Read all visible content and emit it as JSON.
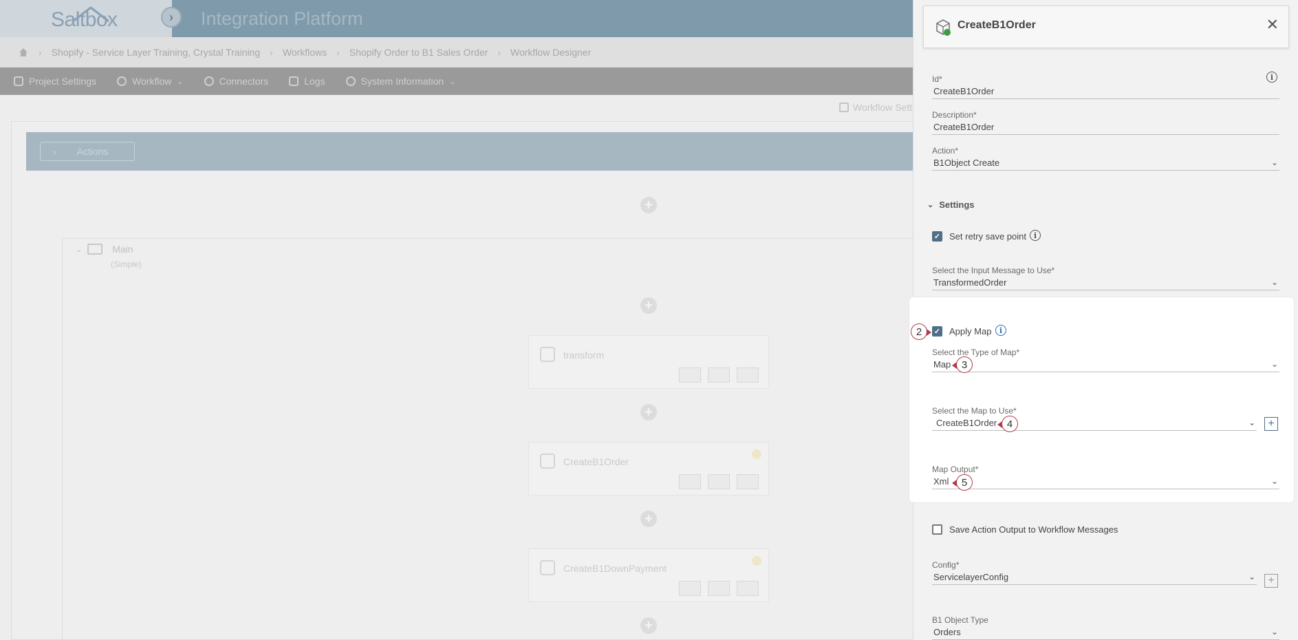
{
  "app": {
    "logo_text": "Saltbox",
    "title": "Integration Platform"
  },
  "breadcrumb": [
    "Shopify - Service Layer Training, Crystal Training",
    "Workflows",
    "Shopify Order to B1 Sales Order",
    "Workflow Designer"
  ],
  "menu": {
    "project_settings": "Project Settings",
    "workflow": "Workflow",
    "connectors": "Connectors",
    "logs": "Logs",
    "system_information": "System Information"
  },
  "workflow_settings_link": "Workflow Sett",
  "canvas": {
    "actions_label": "Actions",
    "main_label": "Main",
    "main_sub": "(Simple)",
    "nodes": [
      {
        "name": "transform"
      },
      {
        "name": "CreateB1Order"
      },
      {
        "name": "CreateB1DownPayment"
      }
    ]
  },
  "panel": {
    "title": "CreateB1Order",
    "id_label": "Id*",
    "id_value": "CreateB1Order",
    "description_label": "Description*",
    "description_value": "CreateB1Order",
    "action_label": "Action*",
    "action_value": "B1Object Create",
    "settings_label": "Settings",
    "retry_label": "Set retry save point",
    "input_message_label": "Select the Input Message to Use*",
    "input_message_value": "TransformedOrder",
    "apply_map_label": "Apply Map",
    "map_type_label": "Select the Type of Map*",
    "map_type_value": "Map",
    "map_use_label": "Select the Map to Use*",
    "map_use_value": "CreateB1Order",
    "map_output_label": "Map Output*",
    "map_output_value": "Xml",
    "save_output_label": "Save Action Output to Workflow Messages",
    "config_label": "Config*",
    "config_value": "ServicelayerConfig",
    "object_type_label": "B1 Object Type",
    "object_type_value": "Orders"
  },
  "callouts": {
    "c2": "2",
    "c3": "3",
    "c4": "4",
    "c5": "5"
  },
  "colors": {
    "accent": "#4f6e87",
    "callout_border": "#b03a48"
  }
}
